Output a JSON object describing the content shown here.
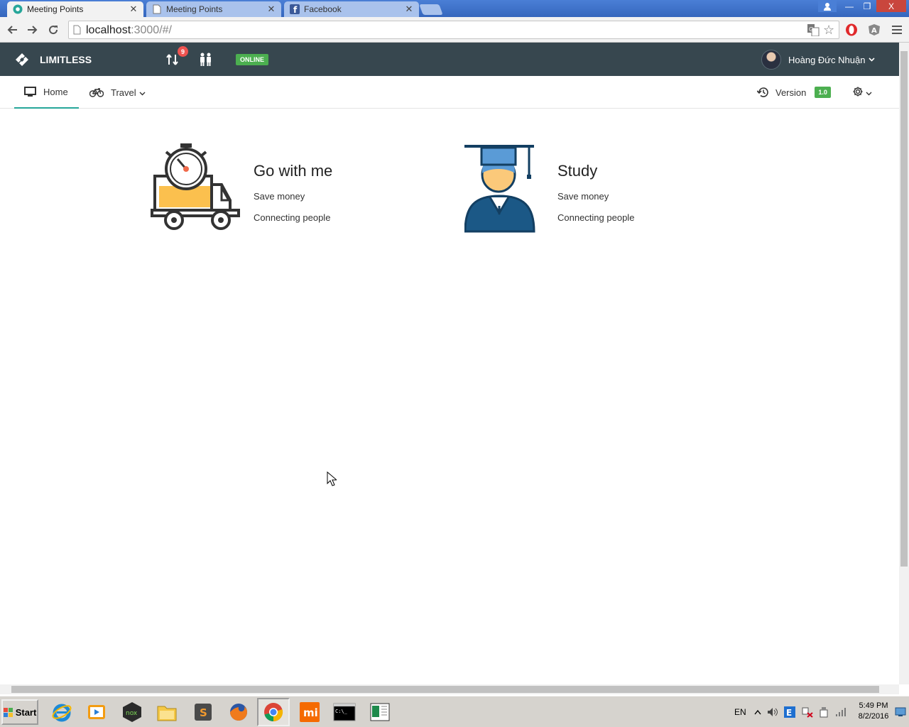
{
  "browser": {
    "tabs": [
      {
        "title": "Meeting Points",
        "active": true
      },
      {
        "title": "Meeting Points",
        "active": false
      },
      {
        "title": "Facebook",
        "active": false
      }
    ],
    "url_host": "localhost",
    "url_path": ":3000/#/",
    "window_controls": {
      "minimize": "—",
      "restore": "❐",
      "close": "X"
    }
  },
  "app": {
    "brand": "LIMITLESS",
    "notification_count": "9",
    "status": "ONLINE",
    "user_name": "Hoàng Đức Nhuận",
    "nav": {
      "home": "Home",
      "travel": "Travel",
      "version_label": "Version",
      "version_value": "1.0"
    },
    "cards": [
      {
        "title": "Go with me",
        "lines": [
          "Save money",
          "Connecting people"
        ],
        "icon": "delivery-truck-stopwatch-icon"
      },
      {
        "title": "Study",
        "lines": [
          "Save money",
          "Connecting people"
        ],
        "icon": "graduate-student-icon"
      }
    ]
  },
  "taskbar": {
    "start_label": "Start",
    "language": "EN",
    "time": "5:49 PM",
    "date": "8/2/2016"
  },
  "colors": {
    "appbar": "#37474f",
    "online": "#4caf50",
    "badge": "#ef5350",
    "active_tab_underline": "#26a69a",
    "truck_yellow": "#fbc04e",
    "grad_blue": "#1b5886"
  }
}
